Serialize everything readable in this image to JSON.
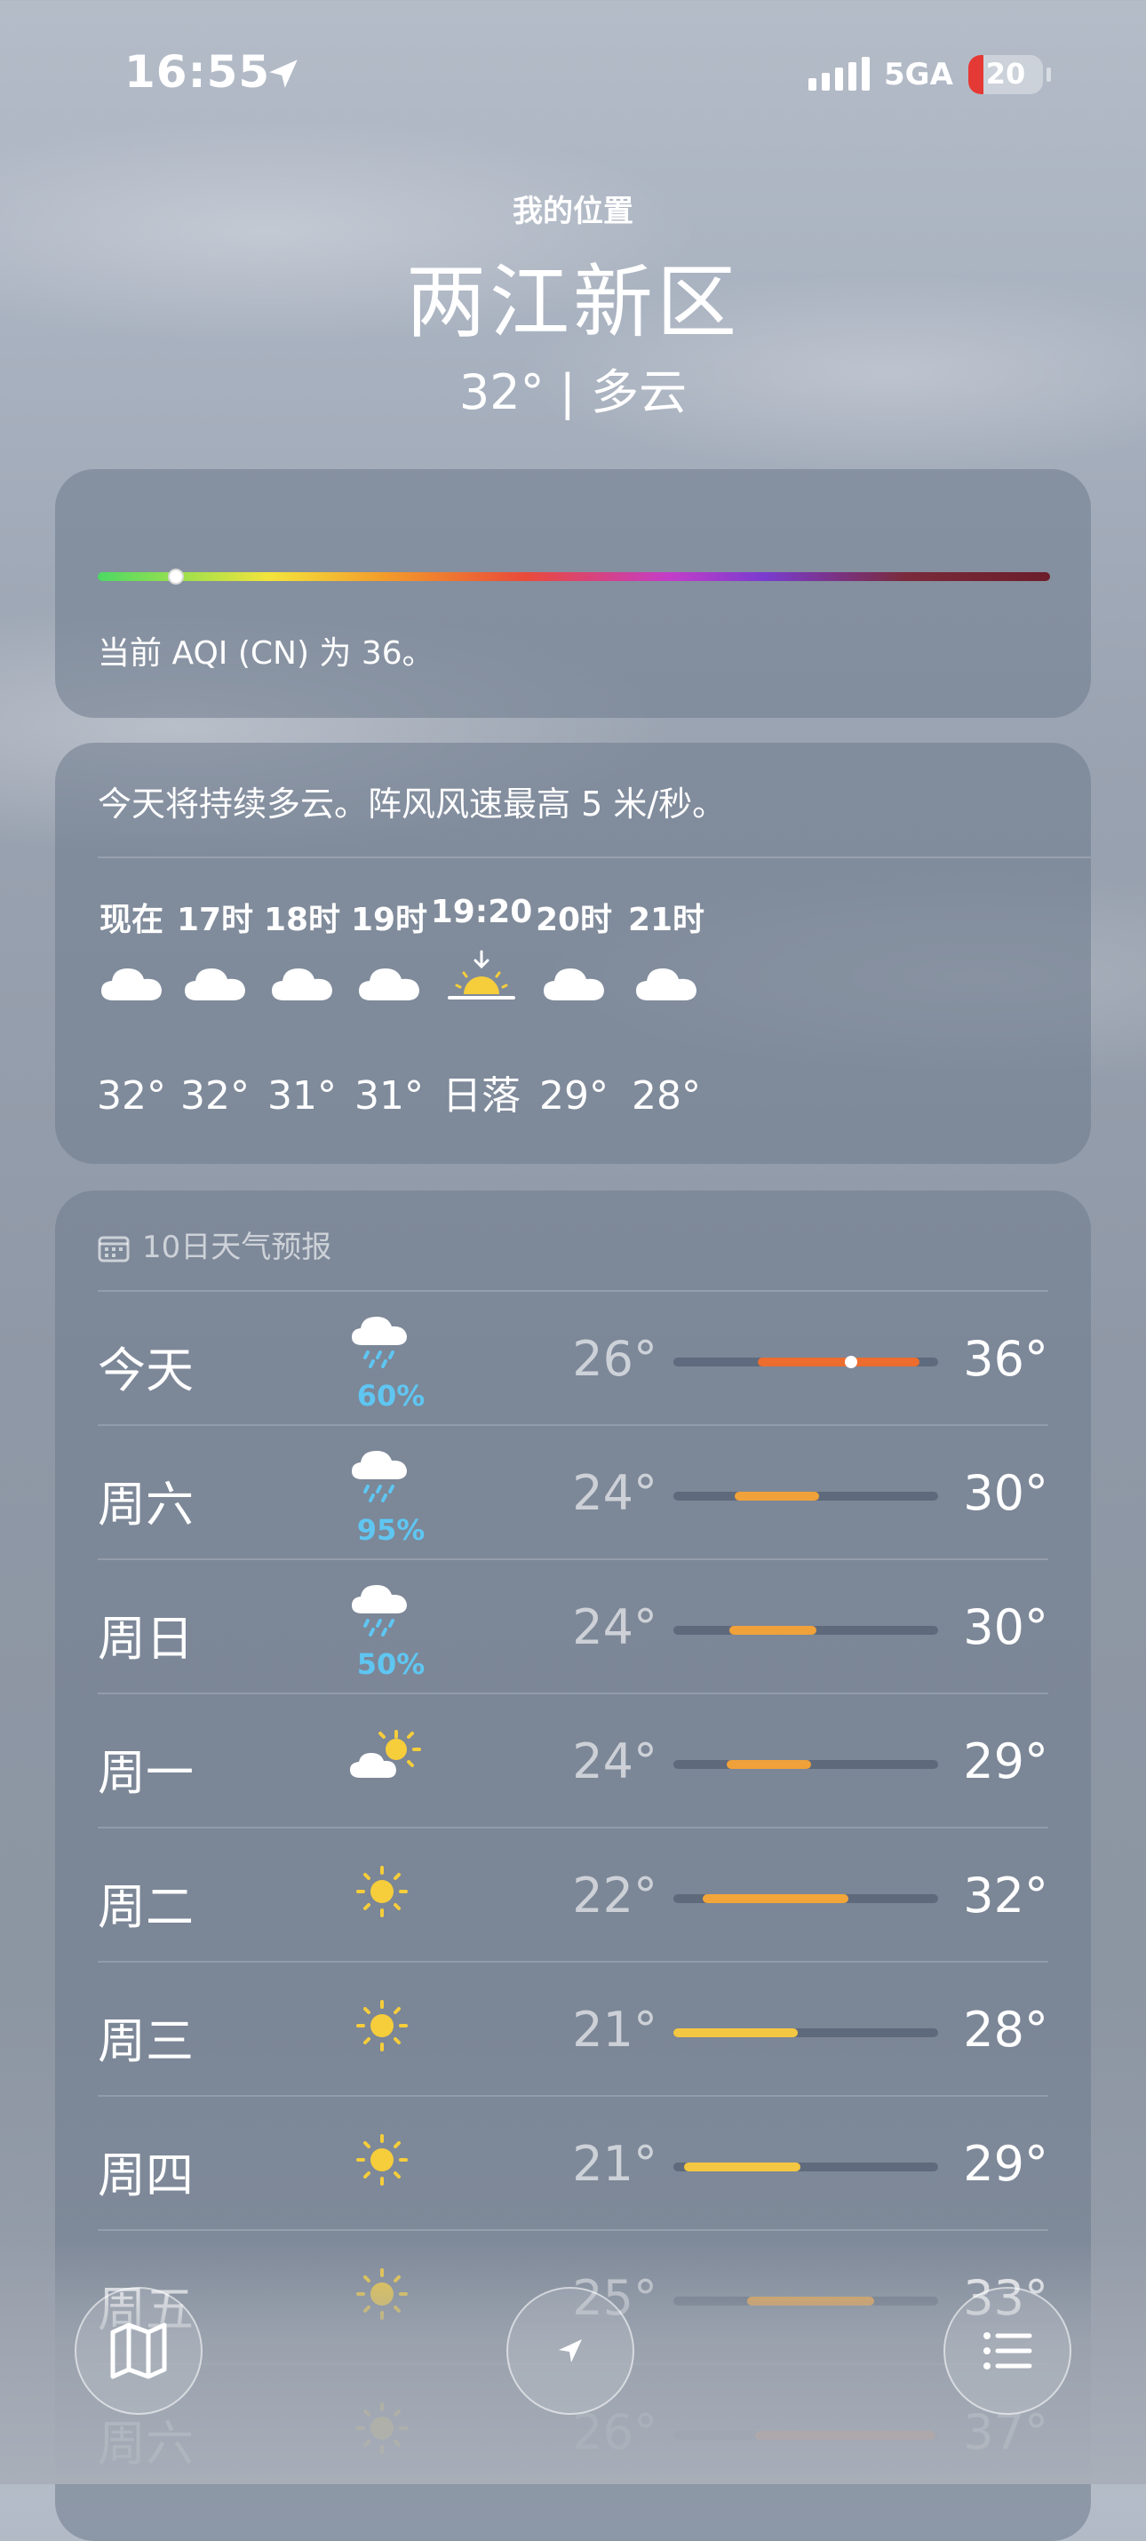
{
  "status_bar": {
    "time": "16:55",
    "network": "5GA",
    "battery": "20"
  },
  "header": {
    "location_label": "我的位置",
    "city": "两江新区",
    "summary": "32° | 多云"
  },
  "aqi": {
    "text": "当前 AQI (CN) 为 36。",
    "value": 36,
    "marker_fraction": 0.08
  },
  "hourly": {
    "summary": "今天将持续多云。阵风风速最高 5 米/秒。",
    "items": [
      {
        "time": "现在",
        "icon": "cloud-icon",
        "value": "32°"
      },
      {
        "time": "17时",
        "icon": "cloud-icon",
        "value": "32°"
      },
      {
        "time": "18时",
        "icon": "cloud-icon",
        "value": "31°"
      },
      {
        "time": "19时",
        "icon": "cloud-icon",
        "value": "31°"
      },
      {
        "time": "19:20",
        "icon": "sunset-icon",
        "value": "日落"
      },
      {
        "time": "20时",
        "icon": "cloud-icon",
        "value": "29°"
      },
      {
        "time": "21时",
        "icon": "cloud-icon",
        "value": "28°"
      }
    ]
  },
  "daily": {
    "title": "10日天气预报",
    "rows": [
      {
        "day": "今天",
        "icon": "cloud-rain-icon",
        "pct": "60%",
        "lo": "26°",
        "hi": "36°",
        "range": [
          0.32,
          0.93
        ],
        "color": "#ec6d2e",
        "current": 0.67
      },
      {
        "day": "周六",
        "icon": "cloud-rain-icon",
        "pct": "95%",
        "lo": "24°",
        "hi": "30°",
        "range": [
          0.23,
          0.55
        ],
        "color": "#f0a13a"
      },
      {
        "day": "周日",
        "icon": "cloud-rain-icon",
        "pct": "50%",
        "lo": "24°",
        "hi": "30°",
        "range": [
          0.21,
          0.54
        ],
        "color": "#f0a13a"
      },
      {
        "day": "周一",
        "icon": "partly-cloudy-icon",
        "pct": "",
        "lo": "24°",
        "hi": "29°",
        "range": [
          0.2,
          0.52
        ],
        "color": "#f0a13a"
      },
      {
        "day": "周二",
        "icon": "sun-icon",
        "pct": "",
        "lo": "22°",
        "hi": "32°",
        "range": [
          0.11,
          0.66
        ],
        "color": "#f2a63a"
      },
      {
        "day": "周三",
        "icon": "sun-icon",
        "pct": "",
        "lo": "21°",
        "hi": "28°",
        "range": [
          0.0,
          0.47
        ],
        "color": "#f4c742"
      },
      {
        "day": "周四",
        "icon": "sun-icon",
        "pct": "",
        "lo": "21°",
        "hi": "29°",
        "range": [
          0.04,
          0.48
        ],
        "color": "#f4c742"
      },
      {
        "day": "周五",
        "icon": "sun-icon",
        "pct": "",
        "lo": "25°",
        "hi": "33°",
        "range": [
          0.28,
          0.76
        ],
        "color": "#f0a13a"
      },
      {
        "day": "周六",
        "icon": "sun-icon",
        "pct": "",
        "lo": "26°",
        "hi": "37°",
        "range": [
          0.31,
          0.99
        ],
        "color": "#ec7a3a"
      }
    ]
  },
  "toolbar": {
    "map_icon": "map-icon",
    "location_icon": "location-arrow-icon",
    "list_icon": "list-icon"
  }
}
